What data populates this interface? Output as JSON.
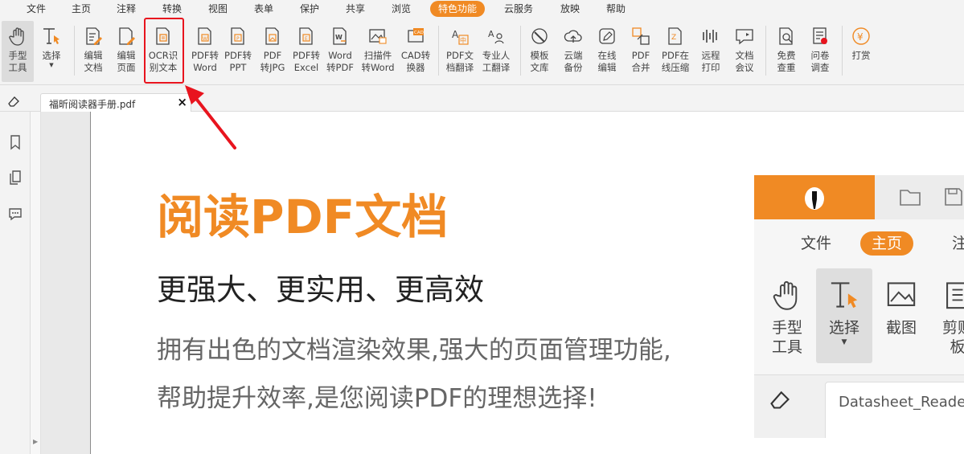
{
  "menu": {
    "items": [
      "文件",
      "主页",
      "注释",
      "转换",
      "视图",
      "表单",
      "保护",
      "共享",
      "浏览",
      "特色功能",
      "云服务",
      "放映",
      "帮助"
    ],
    "active": "特色功能"
  },
  "ribbon": {
    "tools": [
      {
        "id": "hand",
        "label": "手型\n工具"
      },
      {
        "id": "select",
        "label": "选择"
      },
      {
        "id": "edit-text",
        "label": "编辑\n文档"
      },
      {
        "id": "edit-page",
        "label": "编辑\n页面"
      },
      {
        "id": "ocr",
        "label": "OCR识\n别文本"
      },
      {
        "id": "pdf2word",
        "label": "PDF转\nWord"
      },
      {
        "id": "pdf2ppt",
        "label": "PDF转\nPPT"
      },
      {
        "id": "pdf2jpg",
        "label": "PDF\n转JPG"
      },
      {
        "id": "pdf2excel",
        "label": "PDF转\nExcel"
      },
      {
        "id": "word2pdf",
        "label": "Word\n转PDF"
      },
      {
        "id": "scan2word",
        "label": "扫描件\n转Word"
      },
      {
        "id": "cad",
        "label": "CAD转\n换器"
      },
      {
        "id": "pdf-translate",
        "label": "PDF文\n档翻译"
      },
      {
        "id": "human-translate",
        "label": "专业人\n工翻译"
      },
      {
        "id": "template",
        "label": "模板\n文库"
      },
      {
        "id": "cloud-backup",
        "label": "云端\n备份"
      },
      {
        "id": "online-edit",
        "label": "在线\n编辑"
      },
      {
        "id": "pdf-merge",
        "label": "PDF\n合并"
      },
      {
        "id": "pdf-compress",
        "label": "PDF在\n线压缩"
      },
      {
        "id": "remote-print",
        "label": "远程\n打印"
      },
      {
        "id": "doc-meeting",
        "label": "文档\n会议"
      },
      {
        "id": "free-check",
        "label": "免费\n查重"
      },
      {
        "id": "survey",
        "label": "问卷\n调查"
      },
      {
        "id": "reward",
        "label": "打赏"
      }
    ]
  },
  "tabs": {
    "doc_title": "福昕阅读器手册.pdf",
    "close_glyph": "×"
  },
  "document": {
    "title": "阅读PDF文档",
    "subtitle": "更强大、更实用、更高效",
    "body_line1": "拥有出色的文档渲染效果,强大的页面管理功能,",
    "body_line2": "帮助提升效率,是您阅读PDF的理想选择!"
  },
  "preview": {
    "tabs": [
      "文件",
      "主页",
      "注"
    ],
    "active_tab": "主页",
    "tools": [
      {
        "id": "hand",
        "label": "手型\n工具"
      },
      {
        "id": "select",
        "label": "选择"
      },
      {
        "id": "screenshot",
        "label": "截图"
      },
      {
        "id": "clipboard",
        "label": "剪贴\n板"
      }
    ],
    "doc_tab": "Datasheet_Reade"
  },
  "colors": {
    "accent": "#f08a24",
    "highlight": "#e8141e"
  }
}
